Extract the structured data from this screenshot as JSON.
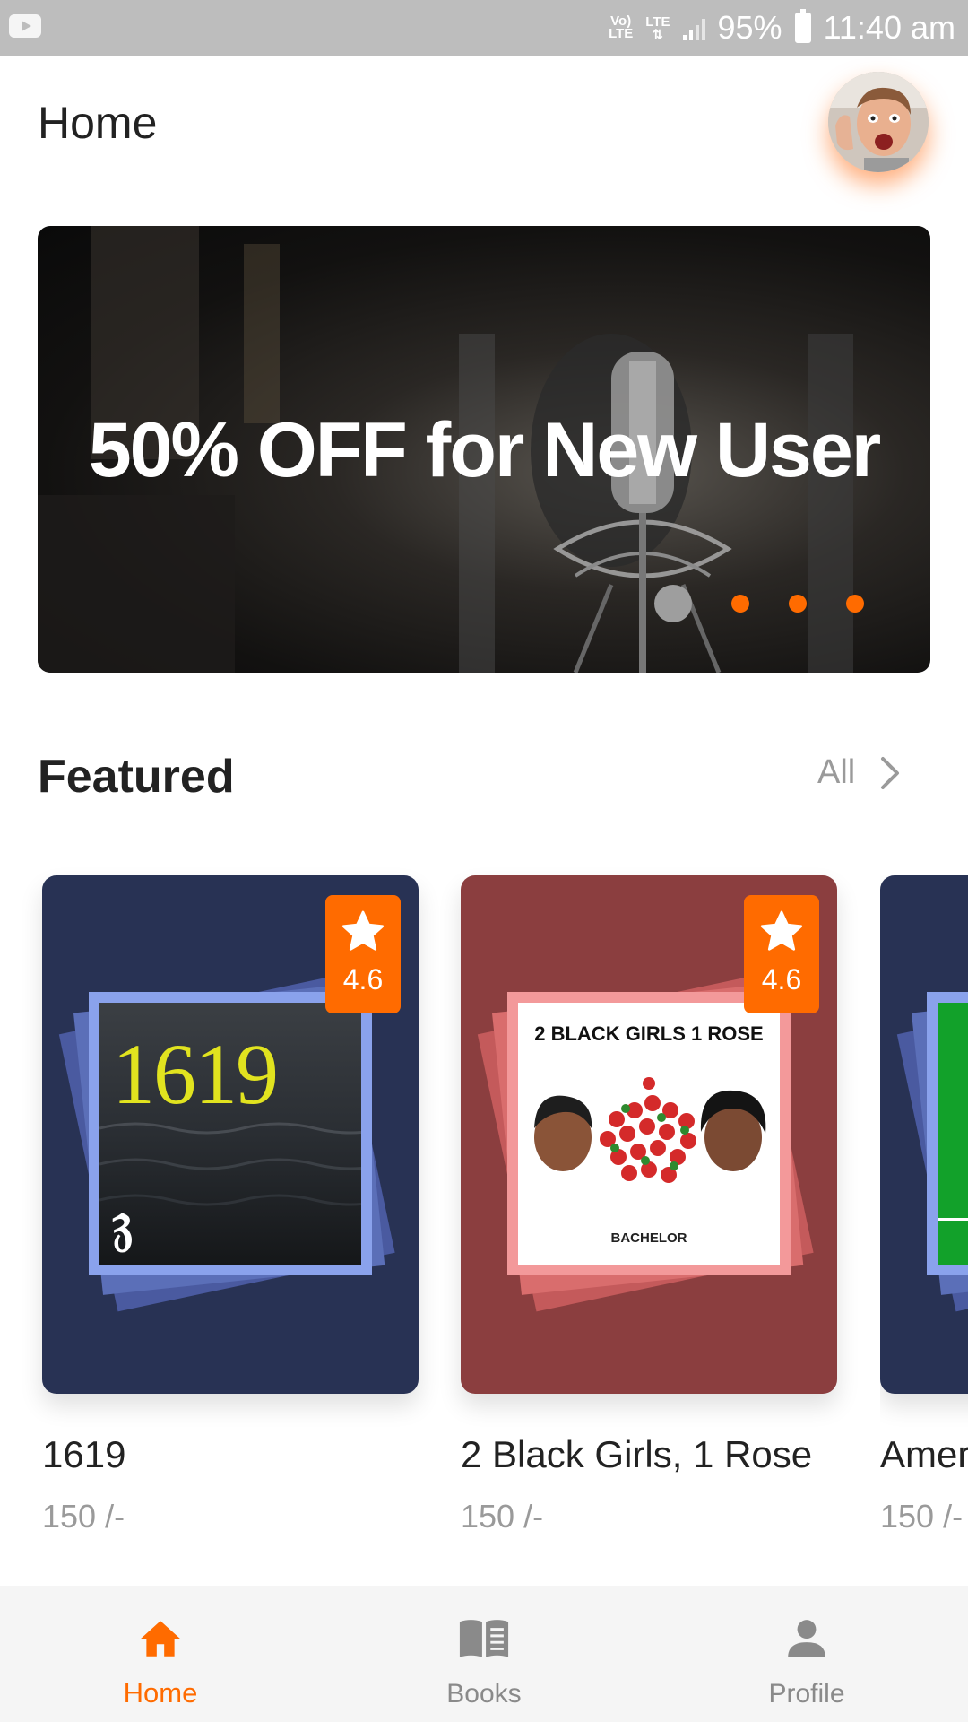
{
  "status_bar": {
    "network_top": "Vo)",
    "network_bottom": "LTE",
    "lte": "LTE",
    "battery": "95%",
    "time": "11:40 am"
  },
  "header": {
    "title": "Home",
    "avatar_icon": "user-avatar-photo"
  },
  "banner": {
    "headline": "50% OFF for New User",
    "dots": 4,
    "active_dot_index": 0,
    "colors": {
      "dot": "#ff6b00",
      "active_dot": "#9e9e9e"
    }
  },
  "featured": {
    "title": "Featured",
    "see_all_label": "All",
    "items": [
      {
        "title": "1619",
        "price": "150 /-",
        "rating": "4.6",
        "cover_text": "1619",
        "card_color": "#283254",
        "stack_color": "#5b6fb8",
        "frame_color": "#8aa2ec"
      },
      {
        "title": "2 Black Girls, 1 Rose",
        "price": "150 /-",
        "rating": "4.6",
        "cover_text": "2 BLACK GIRLS 1 ROSE",
        "cover_footer": "BACHELOR",
        "card_color": "#8b3e3f",
        "stack_color": "#d96d6d",
        "frame_color": "#f3999a"
      },
      {
        "title": "Amer",
        "price": "150 /-",
        "card_color": "#283254",
        "stack_color": "#5b6fb8",
        "frame_color": "#8aa2ec"
      }
    ]
  },
  "bottom_nav": {
    "items": [
      {
        "label": "Home",
        "icon": "home-icon",
        "active": true
      },
      {
        "label": "Books",
        "icon": "book-icon",
        "active": false
      },
      {
        "label": "Profile",
        "icon": "person-icon",
        "active": false
      }
    ],
    "accent": "#ff6b00"
  }
}
